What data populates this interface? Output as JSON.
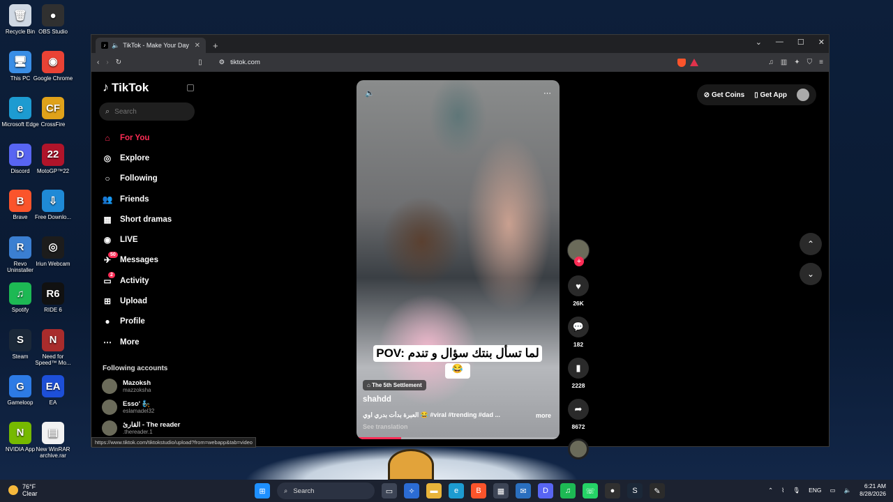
{
  "desktop": {
    "icons": [
      {
        "label": "Recycle Bin",
        "glyph": "🗑",
        "color": "#cfd8e3"
      },
      {
        "label": "OBS Studio",
        "glyph": "●",
        "color": "#303030"
      },
      {
        "label": "This PC",
        "glyph": "🖥",
        "color": "#3a8ee6"
      },
      {
        "label": "Google Chrome",
        "glyph": "◉",
        "color": "#e94235"
      },
      {
        "label": "Microsoft Edge",
        "glyph": "e",
        "color": "#1d9bd1"
      },
      {
        "label": "CrossFire",
        "glyph": "CF",
        "color": "#e0a21a"
      },
      {
        "label": "Discord",
        "glyph": "D",
        "color": "#5865f2"
      },
      {
        "label": "MotoGP™22",
        "glyph": "22",
        "color": "#b0142a"
      },
      {
        "label": "Brave",
        "glyph": "B",
        "color": "#fb542b"
      },
      {
        "label": "Free Downlo...",
        "glyph": "⇩",
        "color": "#1f8ad6"
      },
      {
        "label": "Revo Uninstaller",
        "glyph": "R",
        "color": "#3b7fd1"
      },
      {
        "label": "Iriun Webcam",
        "glyph": "◎",
        "color": "#1c1c1c"
      },
      {
        "label": "Spotify",
        "glyph": "♫",
        "color": "#1db954"
      },
      {
        "label": "RIDE 6",
        "glyph": "R6",
        "color": "#111111"
      },
      {
        "label": "Steam",
        "glyph": "S",
        "color": "#1b2838"
      },
      {
        "label": "Need for Speed™ Mo...",
        "glyph": "N",
        "color": "#a82c2c"
      },
      {
        "label": "Gameloop",
        "glyph": "G",
        "color": "#2d7be5"
      },
      {
        "label": "EA",
        "glyph": "EA",
        "color": "#1d4fd8"
      },
      {
        "label": "NVIDIA App",
        "glyph": "N",
        "color": "#76b900"
      },
      {
        "label": "New WinRAR archive.rar",
        "glyph": "▤",
        "color": "#f2f2f2"
      }
    ]
  },
  "browser": {
    "tab_title": "TikTok - Make Your Day",
    "new_tab": "+",
    "url": "tiktok.com",
    "status_url": "https://www.tiktok.com/tiktokstudio/upload?from=webapp&tab=video",
    "win_min": "—",
    "win_max": "☐",
    "win_close": "✕"
  },
  "sidebar": {
    "logo": "TikTok",
    "search_placeholder": "Search",
    "nav": [
      {
        "label": "For You",
        "icon": "home-icon",
        "glyph": "⌂"
      },
      {
        "label": "Explore",
        "icon": "compass-icon",
        "glyph": "◎"
      },
      {
        "label": "Following",
        "icon": "following-icon",
        "glyph": "○"
      },
      {
        "label": "Friends",
        "icon": "friends-icon",
        "glyph": "👥"
      },
      {
        "label": "Short dramas",
        "icon": "film-icon",
        "glyph": "▦"
      },
      {
        "label": "LIVE",
        "icon": "live-icon",
        "glyph": "◉"
      },
      {
        "label": "Messages",
        "icon": "messages-icon",
        "glyph": "✈",
        "badge": "50"
      },
      {
        "label": "Activity",
        "icon": "activity-icon",
        "glyph": "▭",
        "badge": "2"
      },
      {
        "label": "Upload",
        "icon": "upload-icon",
        "glyph": "⊞"
      },
      {
        "label": "Profile",
        "icon": "profile-icon",
        "glyph": "●"
      },
      {
        "label": "More",
        "icon": "more-icon",
        "glyph": "⋯"
      }
    ],
    "following_heading": "Following accounts",
    "accounts": [
      {
        "name": "Mazoksh",
        "handle": "mazzoksha"
      },
      {
        "name": "Esso' 🧞",
        "handle": "eslamadel32"
      },
      {
        "name": "القارئ - The reader",
        "handle": ".thereader.1"
      }
    ]
  },
  "video": {
    "caption": "POV: لما تسأل بنتك سؤال و تندم",
    "caption_emoji": "😂",
    "sticker": "The 5th Settlement",
    "author": "shahdd",
    "description": "العبرة بدأت بدري اوي 😂 #viral #trending #dad ...",
    "more": "more",
    "see_translation": "See translation",
    "progress": 0.22
  },
  "actions": {
    "likes": "26K",
    "comments": "182",
    "saves": "2228",
    "shares": "8672"
  },
  "topbar": {
    "get_coins": "Get Coins",
    "get_app": "Get App"
  },
  "taskbar": {
    "temp": "76°F",
    "weather": "Clear",
    "search": "Search",
    "lang": "ENG",
    "time": "6:21 AM",
    "date": "8/28/2026"
  }
}
